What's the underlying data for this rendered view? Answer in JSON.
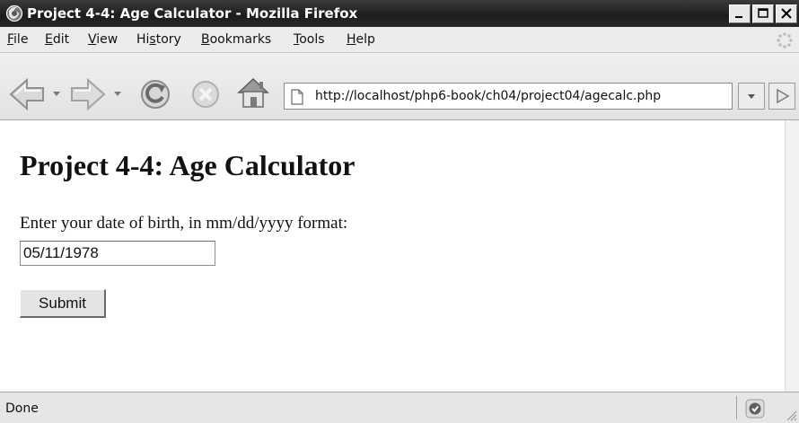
{
  "window": {
    "title": "Project 4-4: Age Calculator - Mozilla Firefox",
    "controls": [
      "minimize-icon",
      "restore-icon",
      "close-icon"
    ]
  },
  "menubar": {
    "items": [
      {
        "pre": "",
        "u": "F",
        "post": "ile"
      },
      {
        "pre": "",
        "u": "E",
        "post": "dit"
      },
      {
        "pre": "",
        "u": "V",
        "post": "iew"
      },
      {
        "pre": "Hi",
        "u": "s",
        "post": "tory"
      },
      {
        "pre": "",
        "u": "B",
        "post": "ookmarks"
      },
      {
        "pre": "",
        "u": "T",
        "post": "ools"
      },
      {
        "pre": "",
        "u": "H",
        "post": "elp"
      }
    ]
  },
  "toolbar": {
    "icons": [
      "back-icon",
      "forward-icon",
      "reload-icon",
      "stop-icon",
      "home-icon"
    ],
    "url": "http://localhost/php6-book/ch04/project04/agecalc.php"
  },
  "page": {
    "heading": "Project 4-4: Age Calculator",
    "prompt": "Enter your date of birth, in mm/dd/yyyy format:",
    "dob_value": "05/11/1978",
    "submit_label": "Submit"
  },
  "statusbar": {
    "text": "Done"
  }
}
